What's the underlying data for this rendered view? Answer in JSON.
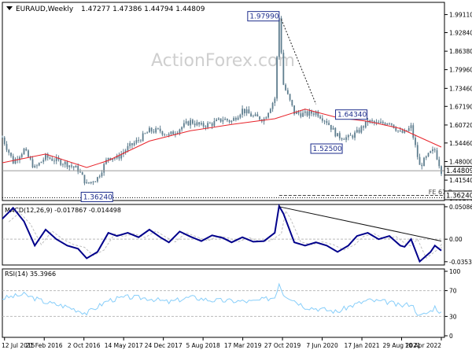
{
  "header": {
    "symbol": "EURAUD,Weekly",
    "ohlc": "1.47277 1.47386 1.44794 1.44809"
  },
  "watermark": "ActionForex.com",
  "colors": {
    "candle": "#5f7e8f",
    "ma": "#e8232a",
    "macd": "#00008b",
    "signal": "#c0c0c0",
    "rsi": "#87cefa",
    "trendline": "#111111",
    "box_border": "#1d2d8c"
  },
  "chart_data": [
    {
      "type": "candlestick",
      "title": "EURAUD,Weekly",
      "ylim": [
        1.35,
        2.02
      ],
      "y_ticks": [
        "1.99110",
        "1.92840",
        "1.86380",
        "1.79960",
        "1.73460",
        "1.67190",
        "1.60720",
        "1.54460",
        "1.48000",
        "1.41540",
        "1.35270"
      ],
      "x_labels": [
        "12 Jul 2015",
        "21 Feb 2016",
        "2 Oct 2016",
        "14 May 2017",
        "24 Dec 2017",
        "5 Aug 2018",
        "17 Mar 2019",
        "27 Oct 2019",
        "7 Jun 2020",
        "17 Jan 2021",
        "29 Aug 2021",
        "10 Apr 2022"
      ],
      "close_path": [
        [
          0,
          1.5636
        ],
        [
          5,
          1.4789
        ],
        [
          10,
          1.5208
        ],
        [
          15,
          1.4563
        ],
        [
          20,
          1.4959
        ],
        [
          25,
          1.4838
        ],
        [
          30,
          1.4716
        ],
        [
          35,
          1.4523
        ],
        [
          39,
          1.4007
        ],
        [
          44,
          1.4233
        ],
        [
          49,
          1.4958
        ],
        [
          53,
          1.4919
        ],
        [
          58,
          1.5275
        ],
        [
          63,
          1.5547
        ],
        [
          68,
          1.587
        ],
        [
          73,
          1.587
        ],
        [
          77,
          1.5708
        ],
        [
          82,
          1.595
        ],
        [
          87,
          1.62
        ],
        [
          92,
          1.604
        ],
        [
          97,
          1.612
        ],
        [
          102,
          1.628
        ],
        [
          106,
          1.62
        ],
        [
          111,
          1.66
        ],
        [
          116,
          1.636
        ],
        [
          121,
          1.628
        ],
        [
          126,
          1.7
        ],
        [
          128,
          1.9799
        ],
        [
          130,
          1.748
        ],
        [
          135,
          1.65
        ],
        [
          140,
          1.644
        ],
        [
          145,
          1.652
        ],
        [
          150,
          1.62
        ],
        [
          155,
          1.568
        ],
        [
          160,
          1.562
        ],
        [
          164,
          1.58
        ],
        [
          169,
          1.62
        ],
        [
          174,
          1.61
        ],
        [
          179,
          1.62
        ],
        [
          184,
          1.58
        ],
        [
          186,
          1.58
        ],
        [
          189,
          1.6
        ],
        [
          193,
          1.464
        ],
        [
          198,
          1.51
        ],
        [
          200,
          1.52
        ],
        [
          203,
          1.4481
        ]
      ],
      "ma_path": [
        [
          0,
          1.4757
        ],
        [
          20,
          1.5061
        ],
        [
          39,
          1.4594
        ],
        [
          49,
          1.4838
        ],
        [
          68,
          1.5514
        ],
        [
          87,
          1.587
        ],
        [
          106,
          1.6091
        ],
        [
          126,
          1.6289
        ],
        [
          140,
          1.6624
        ],
        [
          155,
          1.6329
        ],
        [
          169,
          1.62
        ],
        [
          184,
          1.595
        ],
        [
          203,
          1.5304
        ]
      ],
      "annotations": [
        {
          "label": "1.97990",
          "x": 128,
          "y": 1.9799
        },
        {
          "label": "1.64340",
          "x": 169,
          "y": 1.6434
        },
        {
          "label": "1.52500",
          "x": 155,
          "y": 1.525
        },
        {
          "label": "1.36240",
          "x": 39,
          "y": 1.3624
        },
        {
          "label": "1.44809",
          "x": 203,
          "y": 1.4481
        },
        {
          "label": "1.36240",
          "x": 203,
          "y": 1.3624
        },
        {
          "label": "FE 61.8",
          "x": 200,
          "y": 1.3724
        }
      ]
    },
    {
      "type": "line",
      "title": "MACD(12,26,9) -0.017867 -0.014498",
      "y_ticks": [
        "0.050863",
        "0.00",
        "-0.035322"
      ],
      "ylim": [
        -0.038,
        0.052
      ],
      "series": [
        {
          "name": "MACD",
          "values": [
            [
              0,
              0.032
            ],
            [
              5,
              0.049
            ],
            [
              10,
              0.028
            ],
            [
              15,
              -0.01
            ],
            [
              20,
              0.015
            ],
            [
              25,
              0.0
            ],
            [
              30,
              -0.01
            ],
            [
              35,
              -0.015
            ],
            [
              39,
              -0.03
            ],
            [
              44,
              -0.02
            ],
            [
              49,
              0.01
            ],
            [
              53,
              0.005
            ],
            [
              58,
              0.01
            ],
            [
              63,
              0.003
            ],
            [
              68,
              0.015
            ],
            [
              73,
              0.003
            ],
            [
              77,
              -0.005
            ],
            [
              82,
              0.012
            ],
            [
              87,
              0.004
            ],
            [
              92,
              -0.003
            ],
            [
              97,
              0.006
            ],
            [
              102,
              0.002
            ],
            [
              106,
              -0.005
            ],
            [
              111,
              0.003
            ],
            [
              116,
              -0.004
            ],
            [
              121,
              -0.003
            ],
            [
              126,
              0.01
            ],
            [
              128,
              0.052
            ],
            [
              130,
              0.04
            ],
            [
              135,
              -0.005
            ],
            [
              140,
              -0.01
            ],
            [
              145,
              -0.005
            ],
            [
              150,
              -0.01
            ],
            [
              155,
              -0.02
            ],
            [
              160,
              -0.01
            ],
            [
              164,
              0.005
            ],
            [
              169,
              0.01
            ],
            [
              174,
              0.0
            ],
            [
              179,
              0.005
            ],
            [
              184,
              -0.01
            ],
            [
              186,
              -0.012
            ],
            [
              189,
              0.0
            ],
            [
              193,
              -0.035
            ],
            [
              198,
              -0.02
            ],
            [
              200,
              -0.01
            ],
            [
              203,
              -0.0179
            ]
          ]
        }
      ]
    },
    {
      "type": "line",
      "title": "RSI(14) 35.3966",
      "y_ticks": [
        "100",
        "70",
        "30",
        "0"
      ],
      "ylim": [
        0,
        100
      ],
      "series": [
        {
          "name": "RSI",
          "values": [
            [
              0,
              58
            ],
            [
              10,
              64
            ],
            [
              20,
              52
            ],
            [
              30,
              45
            ],
            [
              39,
              35
            ],
            [
              49,
              55
            ],
            [
              58,
              60
            ],
            [
              68,
              58
            ],
            [
              77,
              52
            ],
            [
              87,
              60
            ],
            [
              97,
              55
            ],
            [
              106,
              54
            ],
            [
              116,
              53
            ],
            [
              126,
              60
            ],
            [
              128,
              82
            ],
            [
              130,
              65
            ],
            [
              140,
              45
            ],
            [
              150,
              40
            ],
            [
              155,
              37
            ],
            [
              160,
              45
            ],
            [
              169,
              55
            ],
            [
              179,
              52
            ],
            [
              184,
              46
            ],
            [
              189,
              50
            ],
            [
              193,
              30
            ],
            [
              198,
              38
            ],
            [
              200,
              45
            ],
            [
              203,
              35
            ]
          ]
        }
      ]
    }
  ]
}
